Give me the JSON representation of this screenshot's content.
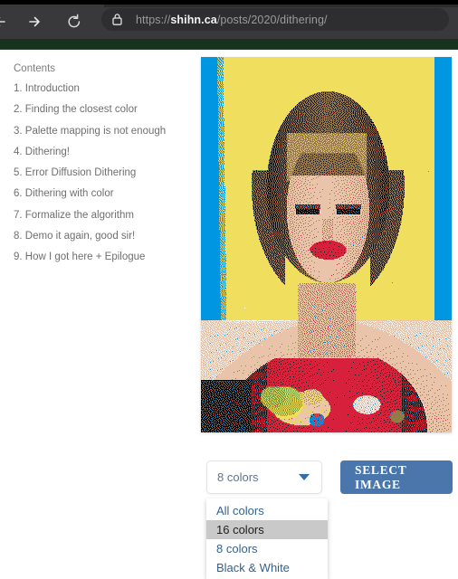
{
  "browser": {
    "back_icon": "arrow-left-icon",
    "forward_icon": "arrow-right-icon",
    "reload_icon": "reload-icon",
    "lock_icon": "lock-icon",
    "url": {
      "scheme": "https://",
      "host": "shihn.ca",
      "path": "/posts/2020/dithering/",
      "full": "https://shihn.ca/posts/2020/dithering/"
    }
  },
  "site": {
    "header_band_color": "#17331f"
  },
  "toc": {
    "heading": "Contents",
    "items": [
      "1. Introduction",
      "2. Finding the closest color",
      "3. Palette mapping is not enough",
      "4. Dithering!",
      "5. Error Diffusion Dithering",
      "6. Dithering with color",
      "7. Formalize the algorithm",
      "8. Demo it again, good sir!",
      "9. How I got here + Epilogue"
    ]
  },
  "demo": {
    "image_alt": "dithered-portrait-photo",
    "palette_select": {
      "name": "palette-select",
      "value": "8 colors",
      "chevron_icon": "chevron-down-icon",
      "expanded": true,
      "options": [
        {
          "label": "All colors",
          "highlighted": false
        },
        {
          "label": "16 colors",
          "highlighted": true
        },
        {
          "label": "8 colors",
          "highlighted": false
        },
        {
          "label": "Black & White",
          "highlighted": false
        }
      ]
    },
    "select_image_button": {
      "label": "SELECT IMAGE",
      "background": "#4a76ab"
    }
  }
}
